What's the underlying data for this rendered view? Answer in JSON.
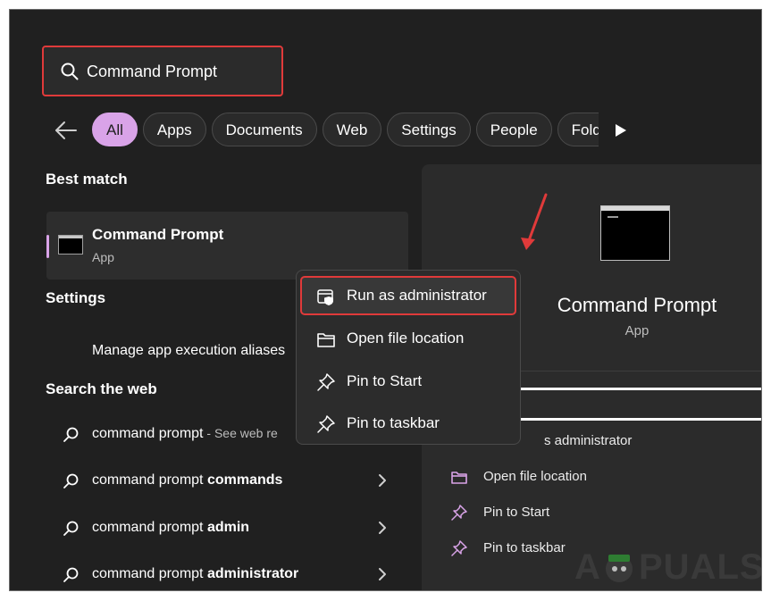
{
  "search": {
    "query": "Command Prompt"
  },
  "filters": [
    "All",
    "Apps",
    "Documents",
    "Web",
    "Settings",
    "People",
    "Folde"
  ],
  "sections": {
    "best_match": "Best match",
    "settings": "Settings",
    "search_web": "Search the web"
  },
  "best_match": {
    "title": "Command Prompt",
    "subtitle": "App"
  },
  "settings_items": [
    "Manage app execution aliases"
  ],
  "web_results": [
    {
      "prefix": "command prompt",
      "bold": "",
      "note": " - See web re"
    },
    {
      "prefix": "command prompt ",
      "bold": "commands",
      "note": ""
    },
    {
      "prefix": "command prompt ",
      "bold": "admin",
      "note": ""
    },
    {
      "prefix": "command prompt ",
      "bold": "administrator",
      "note": ""
    }
  ],
  "context_menu": [
    "Run as administrator",
    "Open file location",
    "Pin to Start",
    "Pin to taskbar"
  ],
  "right_panel": {
    "title": "Command Prompt",
    "subtitle": "App",
    "actions": [
      "s administrator",
      "Open file location",
      "Pin to Start",
      "Pin to taskbar"
    ]
  },
  "watermark": {
    "left": "A",
    "right": "PUALS"
  },
  "colors": {
    "accent": "#d9a3e8",
    "highlight_border": "#e03a3a",
    "background": "#202020",
    "panel": "#2b2b2b"
  },
  "icons": [
    "search-icon",
    "back-arrow-icon",
    "play-arrow-icon",
    "terminal-icon",
    "chevron-right-icon",
    "shield-icon",
    "folder-icon",
    "pin-icon"
  ]
}
